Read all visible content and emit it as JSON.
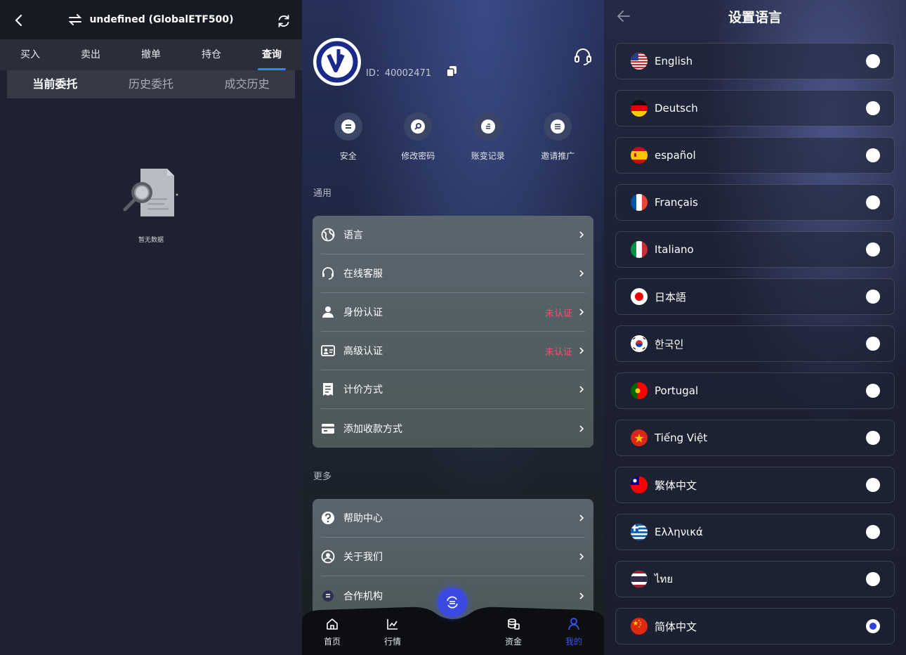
{
  "panel1": {
    "title": "undefined (GlobalETF500)",
    "tabs": [
      "买入",
      "卖出",
      "撤单",
      "持仓",
      "查询"
    ],
    "active_tab": 4,
    "subtabs": [
      "当前委托",
      "历史委托",
      "成交历史"
    ],
    "empty_text": "暂无数据"
  },
  "panel2": {
    "user_id": "ID：40002471",
    "quick_actions": [
      "安全",
      "修改密码",
      "账变记录",
      "邀请推广"
    ],
    "general_label": "通用",
    "general_items": [
      {
        "label": "语言",
        "status": ""
      },
      {
        "label": "在线客服",
        "status": ""
      },
      {
        "label": "身份认证",
        "status": "未认证"
      },
      {
        "label": "高级认证",
        "status": "未认证"
      },
      {
        "label": "计价方式",
        "status": ""
      },
      {
        "label": "添加收款方式",
        "status": ""
      }
    ],
    "more_label": "更多",
    "more_items": [
      {
        "label": "帮助中心"
      },
      {
        "label": "关于我们"
      },
      {
        "label": "合作机构"
      }
    ],
    "tabbar": [
      "首页",
      "行情",
      "资金",
      "我的"
    ],
    "active_tabbar": 3
  },
  "panel3": {
    "title": "设置语言",
    "languages": [
      {
        "label": "English",
        "selected": false
      },
      {
        "label": "Deutsch",
        "selected": false
      },
      {
        "label": "español",
        "selected": false
      },
      {
        "label": "Français",
        "selected": false
      },
      {
        "label": "Italiano",
        "selected": false
      },
      {
        "label": "日本語",
        "selected": false
      },
      {
        "label": "한국인",
        "selected": false
      },
      {
        "label": "Portugal",
        "selected": false
      },
      {
        "label": "Tiếng Việt",
        "selected": false
      },
      {
        "label": "繁体中文",
        "selected": false
      },
      {
        "label": "Ελληνικά",
        "selected": false
      },
      {
        "label": "ไทย",
        "selected": false
      },
      {
        "label": "简体中文",
        "selected": true
      }
    ]
  },
  "colors": {
    "accent": "#3c55f0",
    "status_red": "#ff4d6d",
    "tab_indicator": "#3b82f6"
  }
}
